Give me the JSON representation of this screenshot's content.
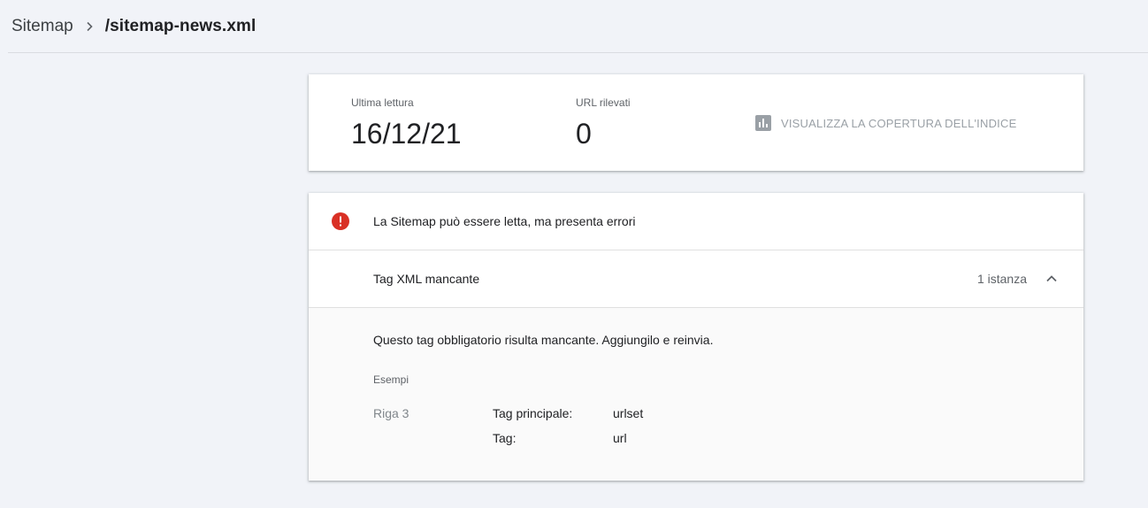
{
  "breadcrumb": {
    "root": "Sitemap",
    "current": "/sitemap-news.xml"
  },
  "stats": {
    "last_read_label": "Ultima lettura",
    "last_read_value": "16/12/21",
    "urls_label": "URL rilevati",
    "urls_value": "0",
    "coverage_link": "VISUALIZZA LA COPERTURA DELL'INDICE"
  },
  "status": {
    "title": "La Sitemap può essere letta, ma presenta errori",
    "error_color": "#d93025"
  },
  "issue": {
    "name": "Tag XML mancante",
    "count": "1 istanza",
    "description": "Questo tag obbligatorio risulta mancante. Aggiungilo e reinvia.",
    "examples_label": "Esempi",
    "example": {
      "row": "Riga 3",
      "parent_tag_label": "Tag principale:",
      "parent_tag_value": "urlset",
      "tag_label": "Tag:",
      "tag_value": "url"
    }
  },
  "icons": {
    "breadcrumb_separator": "chevron-right-icon",
    "coverage": "bar-chart-icon",
    "error": "error-icon",
    "collapse": "chevron-up-icon"
  }
}
